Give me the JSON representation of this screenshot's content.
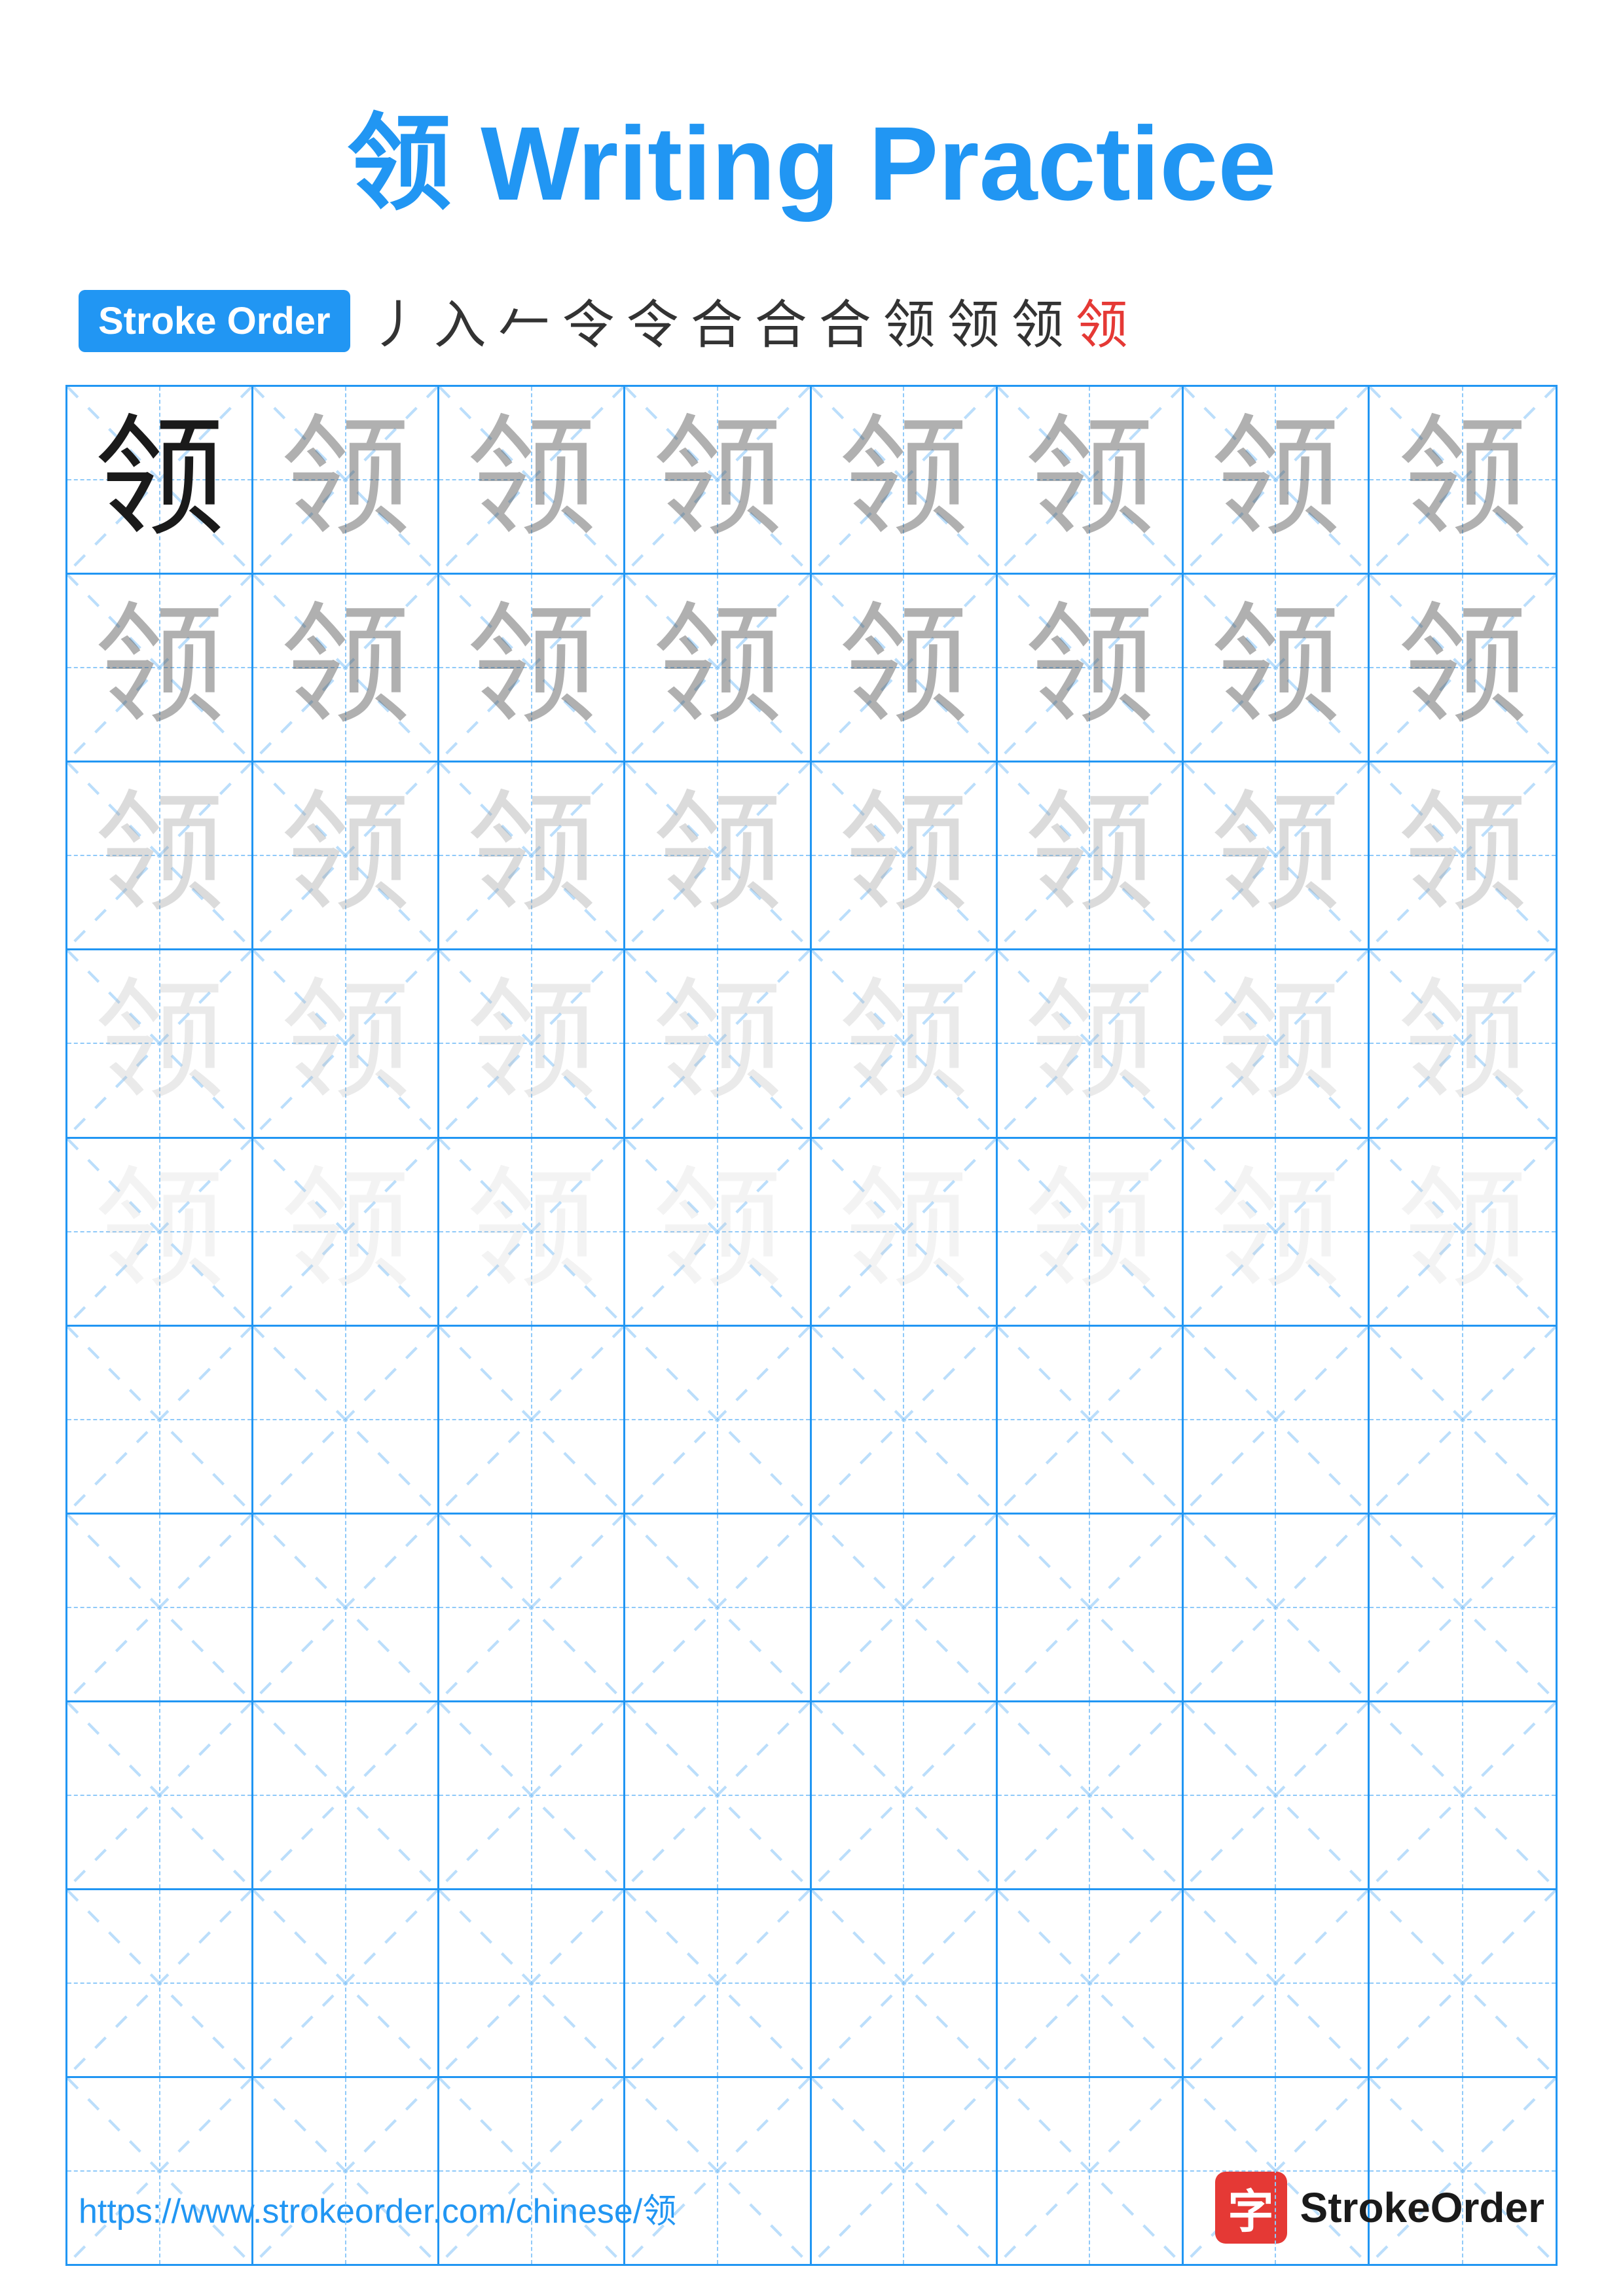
{
  "title": {
    "text": "领 Writing Practice",
    "char": "领"
  },
  "stroke_order": {
    "badge_label": "Stroke Order",
    "strokes": [
      "丿",
      "入",
      "𠂉",
      "令",
      "令",
      "合",
      "合⁻",
      "合⁻",
      "领",
      "领",
      "领",
      "领"
    ]
  },
  "grid": {
    "rows": 10,
    "cols": 8,
    "char": "领",
    "practice_rows": 5,
    "empty_rows": 5
  },
  "footer": {
    "url": "https://www.strokeorder.com/chinese/领",
    "logo_char": "字",
    "logo_text": "StrokeOrder"
  }
}
